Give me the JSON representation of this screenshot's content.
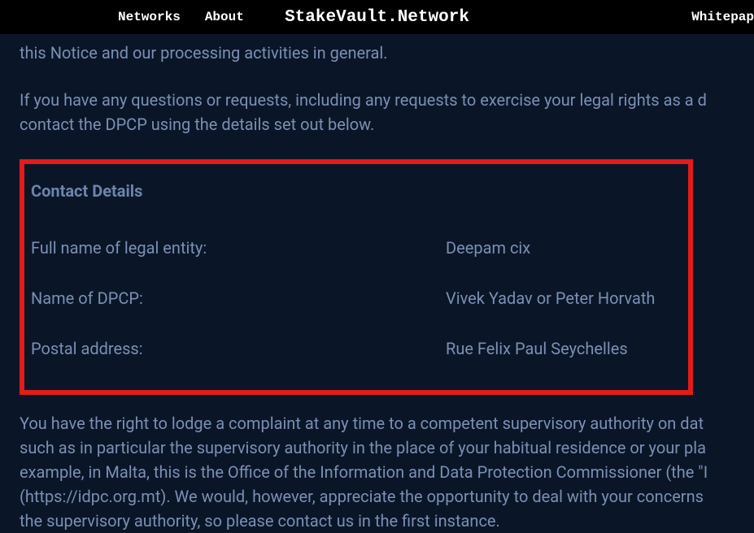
{
  "header": {
    "nav_networks": "Networks",
    "nav_about": "About",
    "brand": "StakeVault.Network",
    "nav_whitepaper": "Whitepap"
  },
  "content": {
    "para1": "this Notice and our processing activities in general.",
    "para2_line1": "If you have any questions or requests, including any requests to exercise your legal rights as a d",
    "para2_line2": "contact the DPCP using the details set out below.",
    "contact": {
      "heading": "Contact Details",
      "rows": [
        {
          "label": "Full name of legal entity:",
          "value": "Deepam cix"
        },
        {
          "label": "Name of DPCP:",
          "value": "Vivek Yadav or Peter Horvath"
        },
        {
          "label": "Postal address:",
          "value": "Rue Felix Paul Seychelles"
        }
      ]
    },
    "para3_line1": "You have the right to lodge a complaint at any time to a competent supervisory authority on dat",
    "para3_line2": "such as in particular the supervisory authority in the place of your habitual residence or your pla",
    "para3_line3": "example, in Malta, this is the Office of the Information and Data Protection Commissioner (the \"I",
    "para3_line4": "(https://idpc.org.mt). We would, however, appreciate the opportunity to deal with your concerns",
    "para3_line5": "the supervisory authority, so please contact us in the first instance."
  }
}
